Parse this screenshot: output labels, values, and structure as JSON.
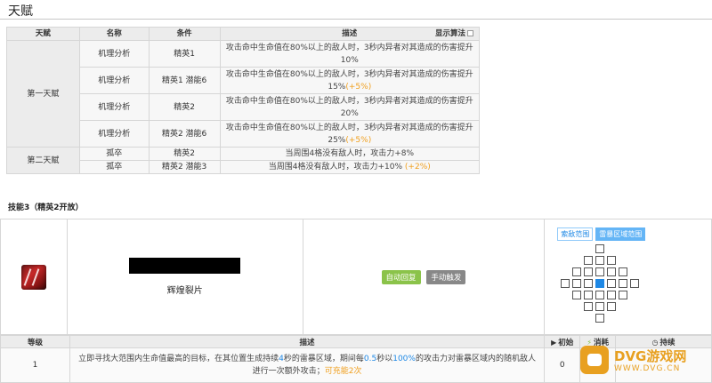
{
  "page_title": "天赋",
  "talent_table": {
    "headers": {
      "talent": "天赋",
      "name": "名称",
      "condition": "条件",
      "description": "描述",
      "show_formula": "显示算法"
    },
    "groups": [
      {
        "label": "第一天赋",
        "rows": [
          {
            "name": "机理分析",
            "condition": "精英1",
            "desc": "攻击命中生命值在80%以上的敌人时，3秒内异者对其造成的伤害提升10%",
            "bonus": ""
          },
          {
            "name": "机理分析",
            "condition": "精英1 潜能6",
            "desc": "攻击命中生命值在80%以上的敌人时，3秒内异者对其造成的伤害提升15%",
            "bonus": "(+5%)"
          },
          {
            "name": "机理分析",
            "condition": "精英2",
            "desc": "攻击命中生命值在80%以上的敌人时，3秒内异者对其造成的伤害提升20%",
            "bonus": ""
          },
          {
            "name": "机理分析",
            "condition": "精英2 潜能6",
            "desc": "攻击命中生命值在80%以上的敌人时，3秒内异者对其造成的伤害提升25%",
            "bonus": "(+5%)"
          }
        ]
      },
      {
        "label": "第二天赋",
        "rows": [
          {
            "name": "孤卒",
            "condition": "精英2",
            "desc": "当周围4格没有敌人时，攻击力+8%",
            "bonus": ""
          },
          {
            "name": "孤卒",
            "condition": "精英2 潜能3",
            "desc": "当周围4格没有敌人时，攻击力+10%",
            "bonus": "(+2%)"
          }
        ]
      }
    ]
  },
  "skill_heading": "技能3（精英2开放）",
  "skill": {
    "name": "辉煌裂片",
    "sp_type": "自动回复",
    "trigger": "手动触发",
    "range_tabs": [
      "索敌范围",
      "雷暴区域范围"
    ]
  },
  "level_table": {
    "headers": {
      "level": "等级",
      "desc": "描述",
      "initial": "初始",
      "cost": "消耗",
      "duration": "持续"
    },
    "rows": [
      {
        "level": "1",
        "desc_parts": {
          "p1": "立即寻找大范围内生命值最高的目标，在其位置生成持续",
          "v1": "4",
          "p2": "秒的雷暴区域，期间每",
          "v2": "0.5",
          "p3": "秒以",
          "v3": "100%",
          "p4": "的攻击力对雷暴区域内的随机敌人进行一次额外攻击；",
          "charge": "可充能2次"
        },
        "initial": "0",
        "cost": "",
        "duration": ""
      }
    ]
  },
  "watermark": {
    "text": "DVG游戏网",
    "url": "WWW.DVG.CN"
  },
  "colors": {
    "highlight": "#f0a020",
    "blue": "#1e88e5",
    "sp_green": "#8bc34a"
  }
}
